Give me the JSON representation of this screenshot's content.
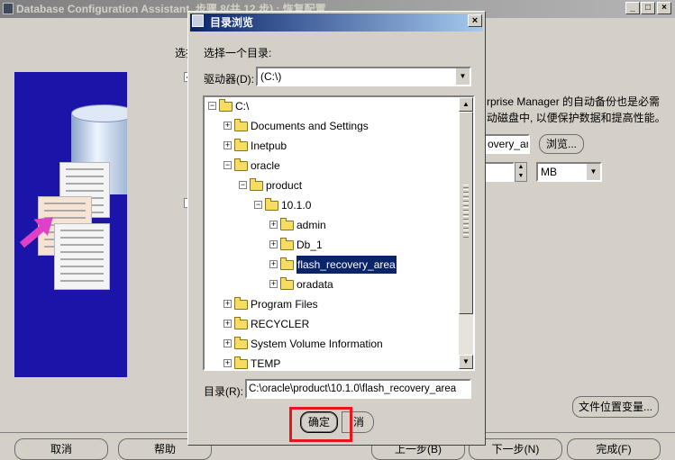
{
  "main_window": {
    "title": "Database Configuration Assistant, 步骤 8(共 12 步) : 恢复配置",
    "controls": {
      "minimize": "_",
      "maximize": "□",
      "close": "×"
    },
    "label_select_partial": "选择",
    "description_line1": "rprise Manager 的自动备份也是必需",
    "description_line2": "动磁盘中, 以便保护数据和提高性能。",
    "recovery_area_value": "overy_area",
    "browse_button": "浏览...",
    "size_unit": "MB",
    "file_location_button": "文件位置变量...",
    "buttons": {
      "cancel": "取消",
      "help": "帮助",
      "back": "上一步(B)",
      "next": "下一步(N)",
      "finish": "完成(F)"
    }
  },
  "dialog": {
    "title": "目录浏览",
    "close": "×",
    "prompt": "选择一个目录:",
    "drive_label": "驱动器(D):",
    "drive_value": "(C:\\)",
    "tree": [
      {
        "label": "C:\\",
        "expander": "−",
        "depth": 0
      },
      {
        "label": "Documents and Settings",
        "expander": "+",
        "depth": 1
      },
      {
        "label": "Inetpub",
        "expander": "+",
        "depth": 1
      },
      {
        "label": "oracle",
        "expander": "−",
        "depth": 1
      },
      {
        "label": "product",
        "expander": "−",
        "depth": 2
      },
      {
        "label": "10.1.0",
        "expander": "−",
        "depth": 3
      },
      {
        "label": "admin",
        "expander": "+",
        "depth": 4
      },
      {
        "label": "Db_1",
        "expander": "+",
        "depth": 4
      },
      {
        "label": "flash_recovery_area",
        "expander": "+",
        "depth": 4,
        "selected": true
      },
      {
        "label": "oradata",
        "expander": "+",
        "depth": 4
      },
      {
        "label": "Program Files",
        "expander": "+",
        "depth": 1
      },
      {
        "label": "RECYCLER",
        "expander": "+",
        "depth": 1
      },
      {
        "label": "System Volume Information",
        "expander": "+",
        "depth": 1
      },
      {
        "label": "TEMP",
        "expander": "+",
        "depth": 1
      }
    ],
    "directory_label": "目录(R):",
    "directory_value": "C:\\oracle\\product\\10.1.0\\flash_recovery_area",
    "ok_button": "确定",
    "cancel_button": "取消",
    "cancel_visible_fragment": "消",
    "highlight_color": "#e4161b"
  },
  "colors": {
    "selection": "#0a246a",
    "dialog_title_start": "#0a246a",
    "dialog_title_end": "#a6caf0",
    "art_background": "#1c14a8"
  }
}
